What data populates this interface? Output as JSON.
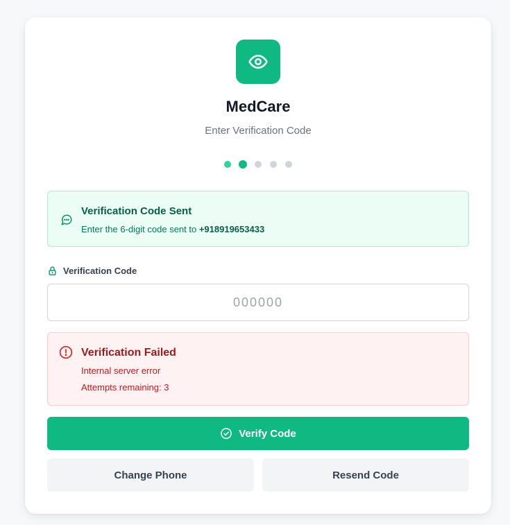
{
  "brand": {
    "name": "MedCare",
    "subtitle": "Enter Verification Code",
    "logo_icon": "eye-icon",
    "accent_color": "#10b981"
  },
  "progress": {
    "total_steps": 5,
    "current_step": 2
  },
  "success_alert": {
    "icon": "message-circle-icon",
    "title": "Verification Code Sent",
    "message_prefix": "Enter the 6-digit code sent to ",
    "phone": "+918919653433"
  },
  "code_field": {
    "icon": "lock-icon",
    "label": "Verification Code",
    "placeholder": "000000",
    "value": ""
  },
  "error_alert": {
    "icon": "alert-circle-icon",
    "title": "Verification Failed",
    "message": "Internal server error",
    "attempts": "Attempts remaining: 3"
  },
  "actions": {
    "verify_icon": "check-circle-icon",
    "verify_label": "Verify Code",
    "change_phone_label": "Change Phone",
    "resend_label": "Resend Code"
  }
}
